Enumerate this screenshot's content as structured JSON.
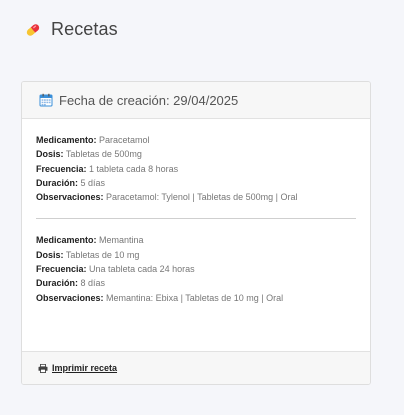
{
  "header": {
    "title": "Recetas",
    "icon": "pill-icon"
  },
  "card": {
    "date_label": "Fecha de creación: 29/04/2025",
    "prescriptions": [
      {
        "medicamento_label": "Medicamento:",
        "medicamento": "Paracetamol",
        "dosis_label": "Dosis:",
        "dosis": "Tabletas de 500mg",
        "frecuencia_label": "Frecuencia:",
        "frecuencia": "1 tableta cada 8 horas",
        "duracion_label": "Duración:",
        "duracion": "5 días",
        "observaciones_label": "Observaciones:",
        "observaciones": "Paracetamol: Tylenol | Tabletas de 500mg | Oral"
      },
      {
        "medicamento_label": "Medicamento:",
        "medicamento": "Memantina",
        "dosis_label": "Dosis:",
        "dosis": "Tabletas de 10 mg",
        "frecuencia_label": "Frecuencia:",
        "frecuencia": "Una tableta cada 24 horas",
        "duracion_label": "Duración:",
        "duracion": "8 días",
        "observaciones_label": "Observaciones:",
        "observaciones": "Memantina: Ebixa | Tabletas de 10 mg | Oral"
      }
    ],
    "print_label": "Imprimir receta"
  },
  "icons": {
    "calendar": "calendar-icon",
    "printer": "printer-icon"
  },
  "colors": {
    "background": "#f5f6fa",
    "pill_red": "#e8323c",
    "pill_yellow": "#f7c531",
    "calendar_blue": "#3a8fd9"
  }
}
